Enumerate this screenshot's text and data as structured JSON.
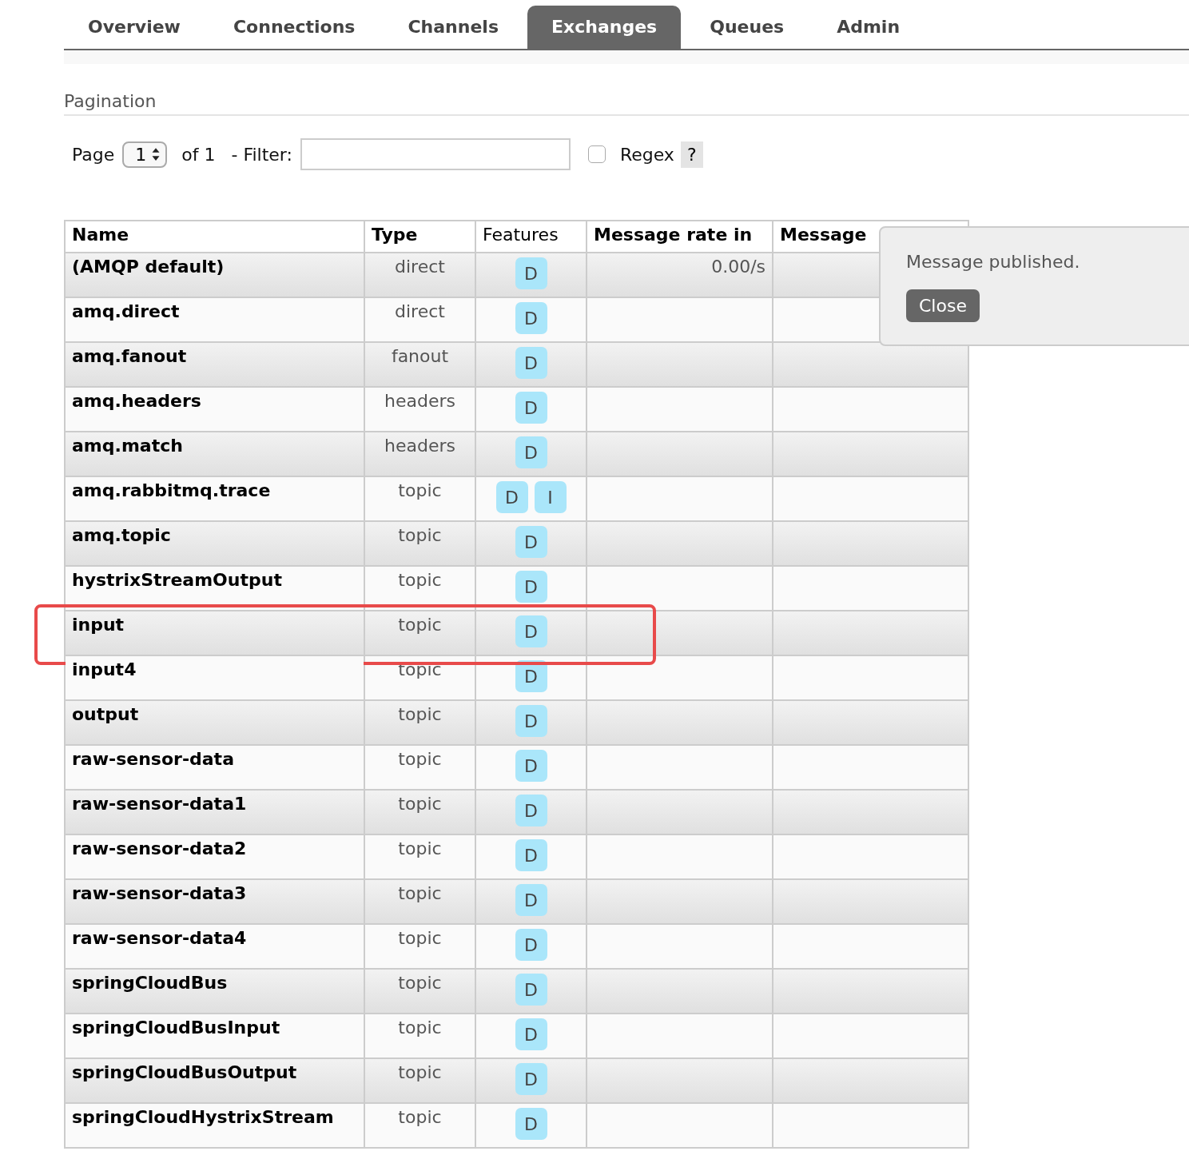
{
  "tabs": [
    {
      "label": "Overview",
      "selected": false
    },
    {
      "label": "Connections",
      "selected": false
    },
    {
      "label": "Channels",
      "selected": false
    },
    {
      "label": "Exchanges",
      "selected": true
    },
    {
      "label": "Queues",
      "selected": false
    },
    {
      "label": "Admin",
      "selected": false
    }
  ],
  "pagination": {
    "heading": "Pagination",
    "page_label": "Page",
    "page_value": "1",
    "of_label": "of 1",
    "filter_label": "- Filter:",
    "regex_label": "Regex",
    "regex_checked": false,
    "help": "?"
  },
  "table": {
    "columns": [
      "Name",
      "Type",
      "Features",
      "Message rate in",
      "Message"
    ],
    "rows": [
      {
        "name": "(AMQP default)",
        "type": "direct",
        "features": [
          "D"
        ],
        "rate_in": "0.00/s",
        "highlighted": false
      },
      {
        "name": "amq.direct",
        "type": "direct",
        "features": [
          "D"
        ],
        "rate_in": "",
        "highlighted": false
      },
      {
        "name": "amq.fanout",
        "type": "fanout",
        "features": [
          "D"
        ],
        "rate_in": "",
        "highlighted": false
      },
      {
        "name": "amq.headers",
        "type": "headers",
        "features": [
          "D"
        ],
        "rate_in": "",
        "highlighted": false
      },
      {
        "name": "amq.match",
        "type": "headers",
        "features": [
          "D"
        ],
        "rate_in": "",
        "highlighted": false
      },
      {
        "name": "amq.rabbitmq.trace",
        "type": "topic",
        "features": [
          "D",
          "I"
        ],
        "rate_in": "",
        "highlighted": false
      },
      {
        "name": "amq.topic",
        "type": "topic",
        "features": [
          "D"
        ],
        "rate_in": "",
        "highlighted": false
      },
      {
        "name": "hystrixStreamOutput",
        "type": "topic",
        "features": [
          "D"
        ],
        "rate_in": "",
        "highlighted": false
      },
      {
        "name": "input",
        "type": "topic",
        "features": [
          "D"
        ],
        "rate_in": "",
        "highlighted": true
      },
      {
        "name": "input4",
        "type": "topic",
        "features": [
          "D"
        ],
        "rate_in": "",
        "highlighted": false
      },
      {
        "name": "output",
        "type": "topic",
        "features": [
          "D"
        ],
        "rate_in": "",
        "highlighted": false
      },
      {
        "name": "raw-sensor-data",
        "type": "topic",
        "features": [
          "D"
        ],
        "rate_in": "",
        "highlighted": false
      },
      {
        "name": "raw-sensor-data1",
        "type": "topic",
        "features": [
          "D"
        ],
        "rate_in": "",
        "highlighted": false
      },
      {
        "name": "raw-sensor-data2",
        "type": "topic",
        "features": [
          "D"
        ],
        "rate_in": "",
        "highlighted": false
      },
      {
        "name": "raw-sensor-data3",
        "type": "topic",
        "features": [
          "D"
        ],
        "rate_in": "",
        "highlighted": false
      },
      {
        "name": "raw-sensor-data4",
        "type": "topic",
        "features": [
          "D"
        ],
        "rate_in": "",
        "highlighted": false
      },
      {
        "name": "springCloudBus",
        "type": "topic",
        "features": [
          "D"
        ],
        "rate_in": "",
        "highlighted": false
      },
      {
        "name": "springCloudBusInput",
        "type": "topic",
        "features": [
          "D"
        ],
        "rate_in": "",
        "highlighted": false
      },
      {
        "name": "springCloudBusOutput",
        "type": "topic",
        "features": [
          "D"
        ],
        "rate_in": "",
        "highlighted": false
      },
      {
        "name": "springCloudHystrixStream",
        "type": "topic",
        "features": [
          "D"
        ],
        "rate_in": "",
        "highlighted": false
      }
    ]
  },
  "popup": {
    "message": "Message published.",
    "button": "Close"
  }
}
